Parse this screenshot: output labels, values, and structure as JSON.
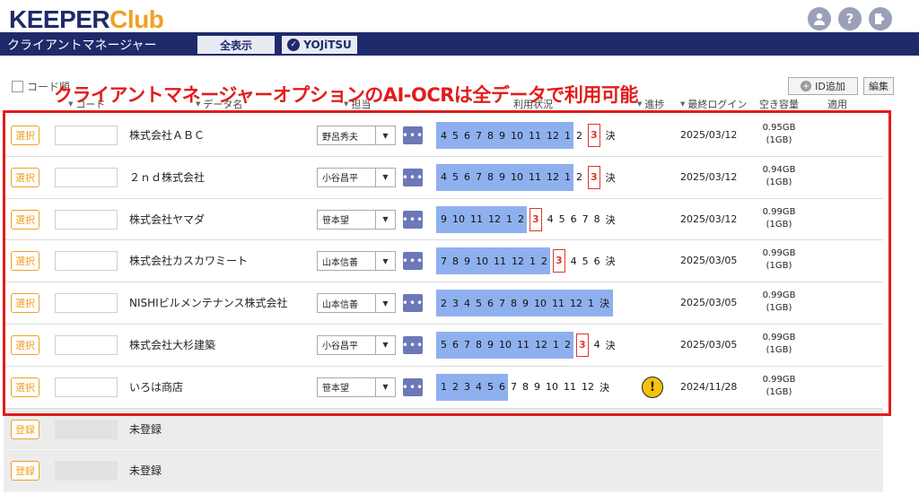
{
  "header": {
    "logo_main": "KEEPER",
    "logo_sub": "Club",
    "icons": [
      "user-icon",
      "help-icon",
      "logout-icon"
    ]
  },
  "nav": {
    "title": "クライアントマネージャー",
    "tab_all": "全表示",
    "tab_yojitsu": "YOJiTSU"
  },
  "controls": {
    "code_checkbox_label": "コード順",
    "add_id_label": "ID追加",
    "edit_label": "編集"
  },
  "columns": {
    "code": "コード",
    "data_name": "データ名",
    "assignee": "担当",
    "usage": "利用状況",
    "progress": "進捗",
    "last_login": "最終ログイン",
    "free_space": "空き容量",
    "apply": "適用"
  },
  "banner": "クライアントマネージャーオプションのAI-OCRは全データで利用可能",
  "colors": {
    "navy": "#1f2a6b",
    "orange": "#f0a024",
    "highlight_red": "#e21c1c",
    "usage_blue": "#8fb0ee",
    "more_button": "#6c78b8"
  },
  "rows": [
    {
      "select": "選択",
      "name": "株式会社ＡＢＣ",
      "assignee": "野呂秀夫",
      "months": [
        "4",
        "5",
        "6",
        "7",
        "8",
        "9",
        "10",
        "11",
        "12",
        "1",
        "2",
        "3",
        "決"
      ],
      "filled": 10,
      "current": 11,
      "warn": false,
      "login": "2025/03/12",
      "free": "0.95GB",
      "total": "(1GB)"
    },
    {
      "select": "選択",
      "name": "２ｎｄ株式会社",
      "assignee": "小谷昌平",
      "months": [
        "4",
        "5",
        "6",
        "7",
        "8",
        "9",
        "10",
        "11",
        "12",
        "1",
        "2",
        "3",
        "決"
      ],
      "filled": 10,
      "current": 11,
      "warn": false,
      "login": "2025/03/12",
      "free": "0.94GB",
      "total": "(1GB)"
    },
    {
      "select": "選択",
      "name": "株式会社ヤマダ",
      "assignee": "笹本望",
      "months": [
        "9",
        "10",
        "11",
        "12",
        "1",
        "2",
        "3",
        "4",
        "5",
        "6",
        "7",
        "8",
        "決"
      ],
      "filled": 6,
      "current": 6,
      "warn": false,
      "login": "2025/03/12",
      "free": "0.99GB",
      "total": "(1GB)"
    },
    {
      "select": "選択",
      "name": "株式会社カスカワミート",
      "assignee": "山本信善",
      "months": [
        "7",
        "8",
        "9",
        "10",
        "11",
        "12",
        "1",
        "2",
        "3",
        "4",
        "5",
        "6",
        "決"
      ],
      "filled": 8,
      "current": 8,
      "warn": false,
      "login": "2025/03/05",
      "free": "0.99GB",
      "total": "(1GB)"
    },
    {
      "select": "選択",
      "name": "NISHIビルメンテナンス株式会社",
      "assignee": "山本信善",
      "months": [
        "2",
        "3",
        "4",
        "5",
        "6",
        "7",
        "8",
        "9",
        "10",
        "11",
        "12",
        "1",
        "決"
      ],
      "filled": 13,
      "current": -1,
      "warn": false,
      "login": "2025/03/05",
      "free": "0.99GB",
      "total": "(1GB)"
    },
    {
      "select": "選択",
      "name": "株式会社大杉建築",
      "assignee": "小谷昌平",
      "months": [
        "5",
        "6",
        "7",
        "8",
        "9",
        "10",
        "11",
        "12",
        "1",
        "2",
        "3",
        "4",
        "決"
      ],
      "filled": 10,
      "current": 10,
      "warn": false,
      "login": "2025/03/05",
      "free": "0.99GB",
      "total": "(1GB)"
    },
    {
      "select": "選択",
      "name": "いろは商店",
      "assignee": "笹本望",
      "months": [
        "1",
        "2",
        "3",
        "4",
        "5",
        "6",
        "7",
        "8",
        "9",
        "10",
        "11",
        "12",
        "決"
      ],
      "filled": 6,
      "current": -1,
      "warn": true,
      "login": "2024/11/28",
      "free": "0.99GB",
      "total": "(1GB)"
    }
  ],
  "unregistered_rows": [
    {
      "button": "登録",
      "name": "未登録"
    },
    {
      "button": "登録",
      "name": "未登録"
    }
  ]
}
